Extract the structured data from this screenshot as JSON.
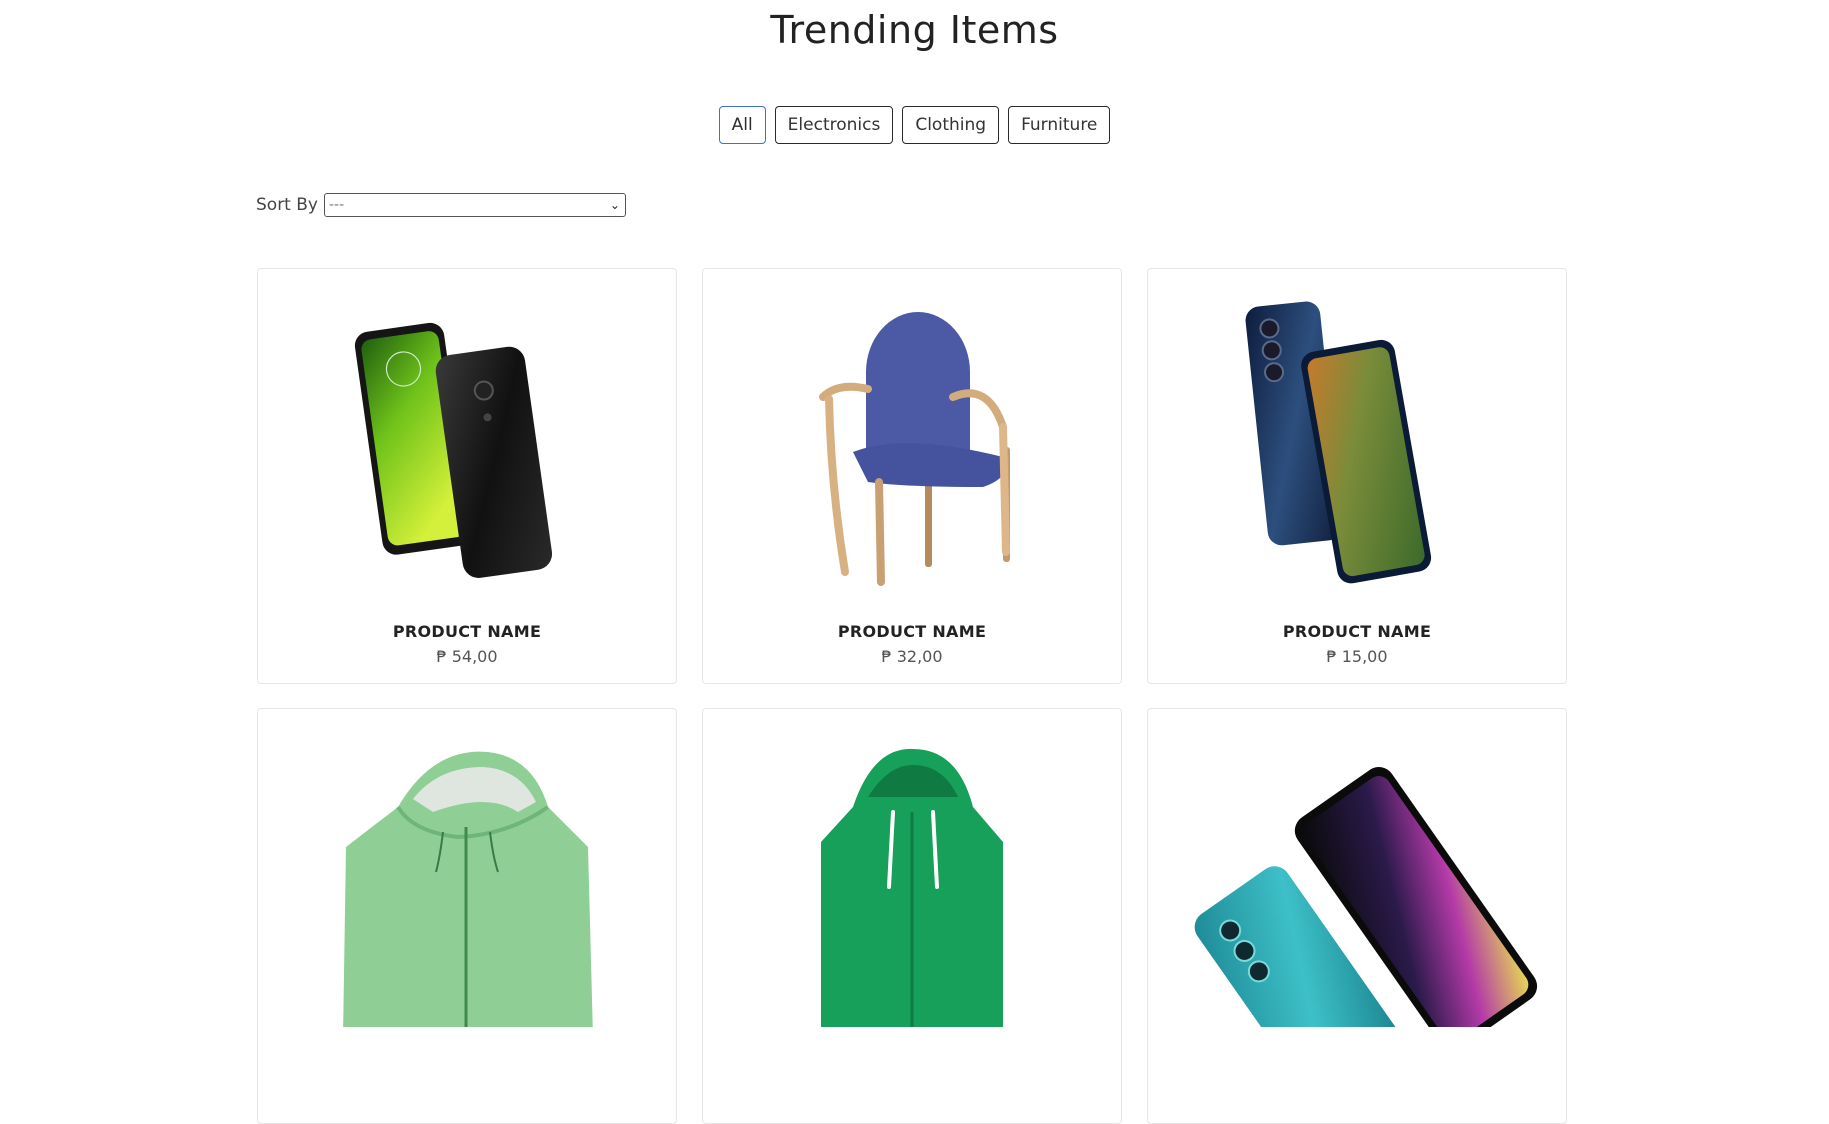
{
  "page": {
    "title": "Trending Items"
  },
  "filters": [
    {
      "label": "All",
      "active": true
    },
    {
      "label": "Electronics",
      "active": false
    },
    {
      "label": "Clothing",
      "active": false
    },
    {
      "label": "Furniture",
      "active": false
    }
  ],
  "sort": {
    "label": "Sort By",
    "selected": "---"
  },
  "products": [
    {
      "name": "PRODUCT NAME",
      "price": "₱ 54,00",
      "image": "green-smartphone-image"
    },
    {
      "name": "PRODUCT NAME",
      "price": "₱ 32,00",
      "image": "blue-armchair-image"
    },
    {
      "name": "PRODUCT NAME",
      "price": "₱ 15,00",
      "image": "blue-smartphone-image"
    },
    {
      "name": "",
      "price": "",
      "image": "light-green-hoodie-image"
    },
    {
      "name": "",
      "price": "",
      "image": "green-hoodie-image"
    },
    {
      "name": "",
      "price": "",
      "image": "teal-smartphone-image"
    }
  ],
  "colors": {
    "active_border": "#3d6fd6",
    "border": "#2a2a2a",
    "card_border": "#e6e6e6"
  }
}
